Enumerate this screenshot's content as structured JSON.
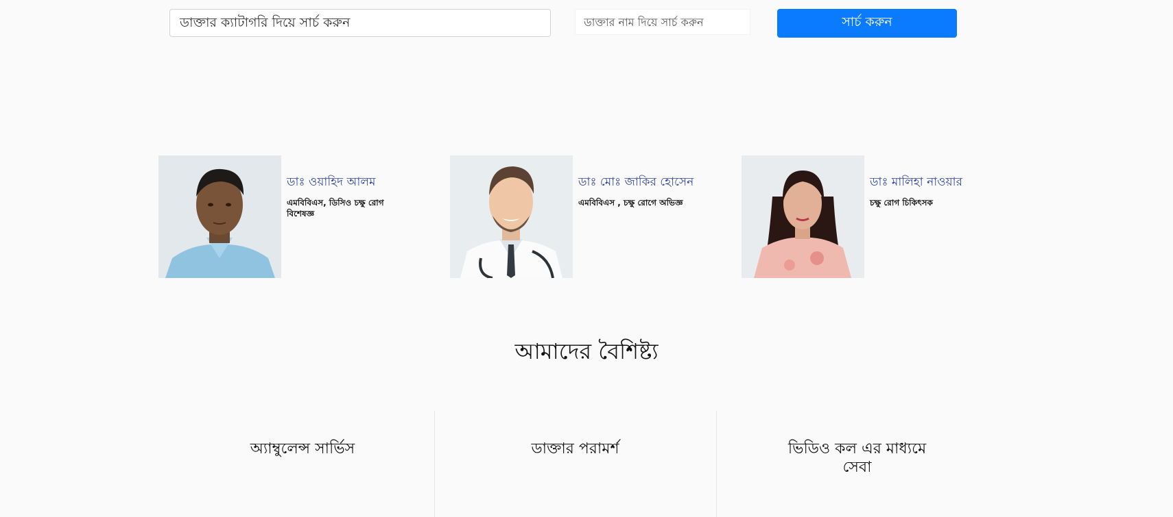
{
  "search": {
    "category_placeholder": "ডাক্তার ক্যাটাগরি দিয়ে সার্চ করুন",
    "name_placeholder": "ডাক্তার নাম দিয়ে সার্চ করুন",
    "button_label": "সার্চ করুন"
  },
  "doctors": [
    {
      "name": "ডাঃ ওয়াহিদ আলম",
      "degree": "এমবিবিএস, ডিসিও চক্ষু রোগ বিশেষজ্ঞ"
    },
    {
      "name": "ডাঃ মোঃ জাকির হোসেন",
      "degree": "এমবিবিএস , চক্ষু রোগে অভিজ্ঞ"
    },
    {
      "name": "ডাঃ মালিহা নাওয়ার",
      "degree": "চক্ষু রোগ চিকিৎসক"
    }
  ],
  "features": {
    "title": "আমাদের বৈশিষ্ট্য",
    "items": [
      {
        "label": "অ্যাম্বুলেন্স সার্ভিস"
      },
      {
        "label": "ডাক্তার পরামর্শ"
      },
      {
        "label": "ভিডিও কল এর মাধ্যমে সেবা"
      }
    ]
  }
}
